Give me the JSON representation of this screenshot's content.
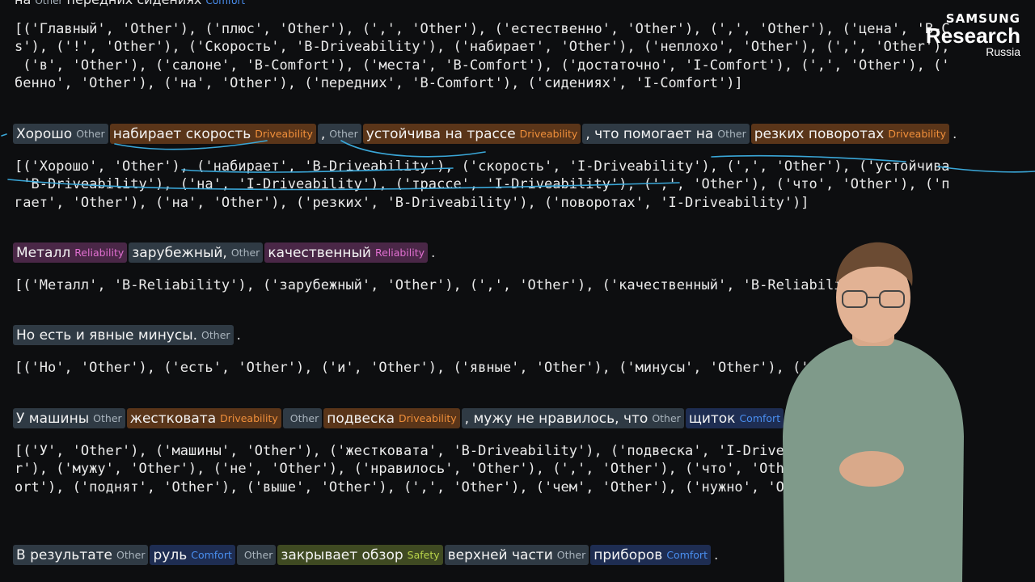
{
  "logo": {
    "line1": "SAMSUNG",
    "line2": "Research",
    "line3": "Russia"
  },
  "top_partial": {
    "word": "на",
    "tag": "Other",
    "word2": "передних сидениях",
    "tag2": "Comfort"
  },
  "blocks": [
    {
      "tokens_text": "[('Главный', 'Other'), ('плюс', 'Other'), (',', 'Other'), ('естественно', 'Other'), (',', 'Other'), ('цена', 'B-C\ns'), ('!', 'Other'), ('Скорость', 'B-Driveability'), ('набирает', 'Other'), ('неплохо', 'Other'), (',', 'Other'),\n ('в', 'Other'), ('салоне', 'B-Comfort'), ('места', 'B-Comfort'), ('достаточно', 'I-Comfort'), (',', 'Other'), ('\nбенно', 'Other'), ('на', 'Other'), ('передних', 'B-Comfort'), ('сидениях', 'I-Comfort')]"
    },
    {
      "sentence": [
        {
          "text": "Хорошо",
          "tag": "Other"
        },
        {
          "text": "набирает скорость",
          "tag": "Driveability"
        },
        {
          "text": ",",
          "tag": "Other"
        },
        {
          "text": "устойчива на трассе",
          "tag": "Driveability"
        },
        {
          "text": ", что помогает на",
          "tag": "Other"
        },
        {
          "text": "резких поворотах",
          "tag": "Driveability"
        }
      ],
      "tokens_text": "[('Хорошо', 'Other'), ('набирает', 'B-Driveability'), ('скорость', 'I-Driveability'), (',', 'Other'), ('устойчива\n 'B-Driveability'), ('на', 'I-Driveability'), ('трассе', 'I-Driveability'), (',', 'Other'), ('что', 'Other'), ('п\nгает', 'Other'), ('на', 'Other'), ('резких', 'B-Driveability'), ('поворотах', 'I-Driveability')]"
    },
    {
      "sentence": [
        {
          "text": "Металл",
          "tag": "Reliability"
        },
        {
          "text": "зарубежный,",
          "tag": "Other"
        },
        {
          "text": "качественный",
          "tag": "Reliability"
        }
      ],
      "tokens_text": "[('Металл', 'B-Reliability'), ('зарубежный', 'Other'), (',', 'Other'), ('качественный', 'B-Reliability')]"
    },
    {
      "sentence": [
        {
          "text": "Но есть и явные минусы.",
          "tag": "Other"
        }
      ],
      "tokens_text": "[('Но', 'Other'), ('есть', 'Other'), ('и', 'Other'), ('явные', 'Other'), ('минусы', 'Other'), ('.', 'Other')]"
    },
    {
      "sentence": [
        {
          "text": "У машины",
          "tag": "Other"
        },
        {
          "text": "жестковата",
          "tag": "Driveability"
        },
        {
          "text": "",
          "tag": "Other"
        },
        {
          "text": "подвеска",
          "tag": "Driveability"
        },
        {
          "text": ", мужу не нравилось, что",
          "tag": "Other"
        },
        {
          "text": "щиток",
          "tag": "Comfort"
        },
        {
          "text": "поднят",
          "tag": "Other"
        }
      ],
      "tokens_text": "[('У', 'Other'), ('машины', 'Other'), ('жестковата', 'B-Driveability'), ('подвеска', 'I-Driveability'), (',', 'Ot\nr'), ('мужу', 'Other'), ('не', 'Other'), ('нравилось', 'Other'), (',', 'Other'), ('что', 'Other'), ('щиток', 'B-C\nort'), ('поднят', 'Other'), ('выше', 'Other'), (',', 'Other'), ('чем', 'Other'), ('нужно', 'Other'), ('.', 'Other"
    },
    {
      "sentence": [
        {
          "text": "В результате",
          "tag": "Other"
        },
        {
          "text": "руль",
          "tag": "Comfort"
        },
        {
          "text": "",
          "tag": "Other"
        },
        {
          "text": "закрывает обзор",
          "tag": "Safety"
        },
        {
          "text": "верхней части",
          "tag": "Other"
        },
        {
          "text": "приборов",
          "tag": "Comfort"
        }
      ]
    }
  ],
  "colors": {
    "Other": "#a9b4bd",
    "Driveability": "#f08f3a",
    "Reliability": "#e06fd0",
    "Comfort": "#4a8ff0",
    "Safety": "#b8d44a",
    "ink": "#3aa7d8"
  }
}
